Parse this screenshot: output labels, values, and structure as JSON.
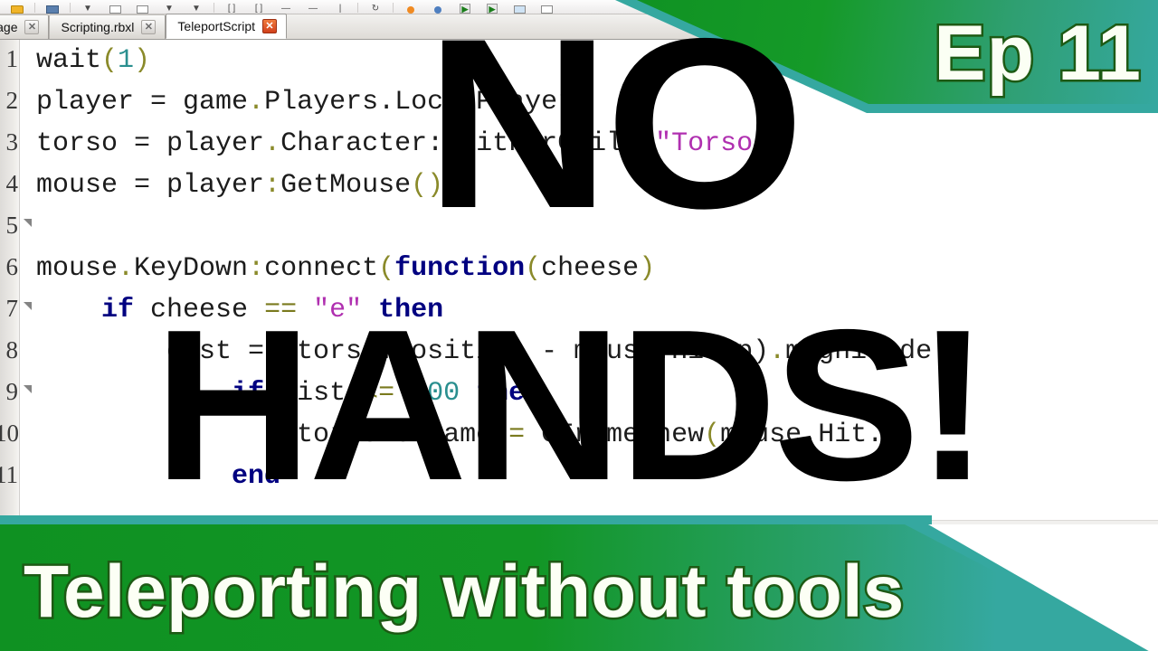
{
  "window": {
    "app": "Roblox Studio",
    "toolbar_icons": [
      "folder-icon",
      "save-icon",
      "chevron-down-icon",
      "box-icon",
      "box-icon",
      "chevron-down-icon",
      "chevron-down-icon",
      "bracket-icon",
      "bracket-icon",
      "dash-icon",
      "dash-icon",
      "bar-icon",
      "refresh-icon",
      "orange-dot-icon",
      "blue-dot-icon",
      "play-green-icon",
      "play-green-icon",
      "window-icon",
      "stop-icon"
    ]
  },
  "tabs": [
    {
      "label": "t Page",
      "close_glyph": "✕",
      "active": false
    },
    {
      "label": "Scripting.rbxl",
      "close_glyph": "✕",
      "active": false
    },
    {
      "label": "TeleportScript",
      "close_glyph": "✕",
      "active": true
    }
  ],
  "editor": {
    "line_numbers": [
      "1",
      "2",
      "3",
      "4",
      "5",
      "6",
      "7",
      "8",
      "9",
      "10",
      "11"
    ],
    "lines": [
      {
        "n": "1",
        "segments": [
          {
            "t": "wait",
            "c": "plain"
          },
          {
            "t": "(",
            "c": "punct"
          },
          {
            "t": "1",
            "c": "num"
          },
          {
            "t": ")",
            "c": "punct"
          }
        ]
      },
      {
        "n": "2",
        "segments": [
          {
            "t": "player = game",
            "c": "plain"
          },
          {
            "t": ".",
            "c": "punct"
          },
          {
            "t": "Players.LocalPlayer",
            "c": "plain"
          }
        ]
      },
      {
        "n": "3",
        "segments": [
          {
            "t": "torso = player",
            "c": "plain"
          },
          {
            "t": ".",
            "c": "punct"
          },
          {
            "t": "Character:WaitForChild",
            "c": "plain"
          },
          {
            "t": "(",
            "c": "punct"
          },
          {
            "t": "\"Torso\"",
            "c": "str"
          },
          {
            "t": ")",
            "c": "punct"
          }
        ]
      },
      {
        "n": "4",
        "segments": [
          {
            "t": "mouse = player",
            "c": "plain"
          },
          {
            "t": ":",
            "c": "punct"
          },
          {
            "t": "GetMouse",
            "c": "plain"
          },
          {
            "t": "()",
            "c": "punct"
          }
        ]
      },
      {
        "n": "5",
        "segments": []
      },
      {
        "n": "6",
        "segments": [
          {
            "t": "mouse",
            "c": "plain"
          },
          {
            "t": ".",
            "c": "punct"
          },
          {
            "t": "KeyDown",
            "c": "plain"
          },
          {
            "t": ":",
            "c": "punct"
          },
          {
            "t": "connect",
            "c": "plain"
          },
          {
            "t": "(",
            "c": "punct"
          },
          {
            "t": "function",
            "c": "kw"
          },
          {
            "t": "(",
            "c": "punct"
          },
          {
            "t": "cheese",
            "c": "plain"
          },
          {
            "t": ")",
            "c": "punct"
          }
        ]
      },
      {
        "n": "7",
        "segments": [
          {
            "t": "    ",
            "c": "plain"
          },
          {
            "t": "if",
            "c": "kw"
          },
          {
            "t": " cheese ",
            "c": "plain"
          },
          {
            "t": "==",
            "c": "op"
          },
          {
            "t": " ",
            "c": "plain"
          },
          {
            "t": "\"e\"",
            "c": "str"
          },
          {
            "t": " ",
            "c": "plain"
          },
          {
            "t": "then",
            "c": "kw"
          }
        ]
      },
      {
        "n": "8",
        "segments": [
          {
            "t": "        dist = (torso.Position - mouse.Hit.p)",
            "c": "plain"
          },
          {
            "t": ".",
            "c": "punct"
          },
          {
            "t": "magnitude",
            "c": "plain"
          }
        ]
      },
      {
        "n": "9",
        "segments": [
          {
            "t": "            ",
            "c": "plain"
          },
          {
            "t": "if",
            "c": "kw"
          },
          {
            "t": " dist ",
            "c": "plain"
          },
          {
            "t": "<=",
            "c": "op"
          },
          {
            "t": " ",
            "c": "plain"
          },
          {
            "t": "100",
            "c": "num"
          },
          {
            "t": " ",
            "c": "plain"
          },
          {
            "t": "then",
            "c": "kw"
          }
        ]
      },
      {
        "n": "10",
        "segments": [
          {
            "t": "                torso.CFrame ",
            "c": "plain"
          },
          {
            "t": "=",
            "c": "op"
          },
          {
            "t": " CFrame.new",
            "c": "plain"
          },
          {
            "t": "(",
            "c": "punct"
          },
          {
            "t": "mouse.Hit.p",
            "c": "plain"
          }
        ]
      },
      {
        "n": "11",
        "segments": [
          {
            "t": "            ",
            "c": "plain"
          },
          {
            "t": "end",
            "c": "kw"
          }
        ]
      }
    ],
    "fold_markers": [
      5,
      7,
      9
    ]
  },
  "overlay": {
    "word_top": "NO",
    "word_bottom": "HANDS!"
  },
  "episode_banner": {
    "label": "Ep 11"
  },
  "title_banner": {
    "label": "Teleporting without tools"
  },
  "colors": {
    "green": "#129625",
    "teal": "#35a8a0",
    "outline_green": "#1d5a14",
    "banner_text": "#fcfff5",
    "overlay_black": "#000000",
    "keyword_blue": "#000080",
    "string_magenta": "#b030b0",
    "number_teal": "#2a8f8f",
    "punct_olive": "#8a8a2a"
  }
}
